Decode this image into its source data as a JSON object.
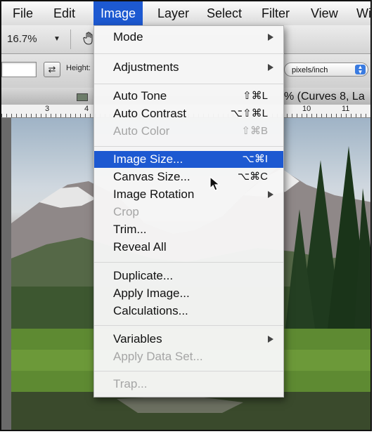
{
  "menubar": {
    "items": [
      "File",
      "Edit",
      "Image",
      "Layer",
      "Select",
      "Filter",
      "View",
      "Wi"
    ]
  },
  "options": {
    "zoom": "16.7%",
    "height_label": "Height:",
    "resolution_unit": "pixels/inch"
  },
  "document": {
    "title": "% (Curves 8, La",
    "ruler_numbers": [
      "3",
      "4",
      "10",
      "11"
    ]
  },
  "image_menu": {
    "sections": [
      [
        {
          "label": "Mode",
          "shortcut": "",
          "submenu": true,
          "enabled": true
        }
      ],
      [
        {
          "label": "Adjustments",
          "shortcut": "",
          "submenu": true,
          "enabled": true
        }
      ],
      [
        {
          "label": "Auto Tone",
          "shortcut": "⇧⌘L",
          "submenu": false,
          "enabled": true
        },
        {
          "label": "Auto Contrast",
          "shortcut": "⌥⇧⌘L",
          "submenu": false,
          "enabled": true
        },
        {
          "label": "Auto Color",
          "shortcut": "⇧⌘B",
          "submenu": false,
          "enabled": false
        }
      ],
      [
        {
          "label": "Image Size...",
          "shortcut": "⌥⌘I",
          "submenu": false,
          "enabled": true,
          "highlighted": true
        },
        {
          "label": "Canvas Size...",
          "shortcut": "⌥⌘C",
          "submenu": false,
          "enabled": true
        },
        {
          "label": "Image Rotation",
          "shortcut": "",
          "submenu": true,
          "enabled": true
        },
        {
          "label": "Crop",
          "shortcut": "",
          "submenu": false,
          "enabled": false
        },
        {
          "label": "Trim...",
          "shortcut": "",
          "submenu": false,
          "enabled": true
        },
        {
          "label": "Reveal All",
          "shortcut": "",
          "submenu": false,
          "enabled": true
        }
      ],
      [
        {
          "label": "Duplicate...",
          "shortcut": "",
          "submenu": false,
          "enabled": true
        },
        {
          "label": "Apply Image...",
          "shortcut": "",
          "submenu": false,
          "enabled": true
        },
        {
          "label": "Calculations...",
          "shortcut": "",
          "submenu": false,
          "enabled": true
        }
      ],
      [
        {
          "label": "Variables",
          "shortcut": "",
          "submenu": true,
          "enabled": true
        },
        {
          "label": "Apply Data Set...",
          "shortcut": "",
          "submenu": false,
          "enabled": false
        }
      ],
      [
        {
          "label": "Trap...",
          "shortcut": "",
          "submenu": false,
          "enabled": false
        }
      ]
    ]
  },
  "colors": {
    "highlight": "#1d59d1",
    "disabled_text": "#a5a5a5"
  }
}
